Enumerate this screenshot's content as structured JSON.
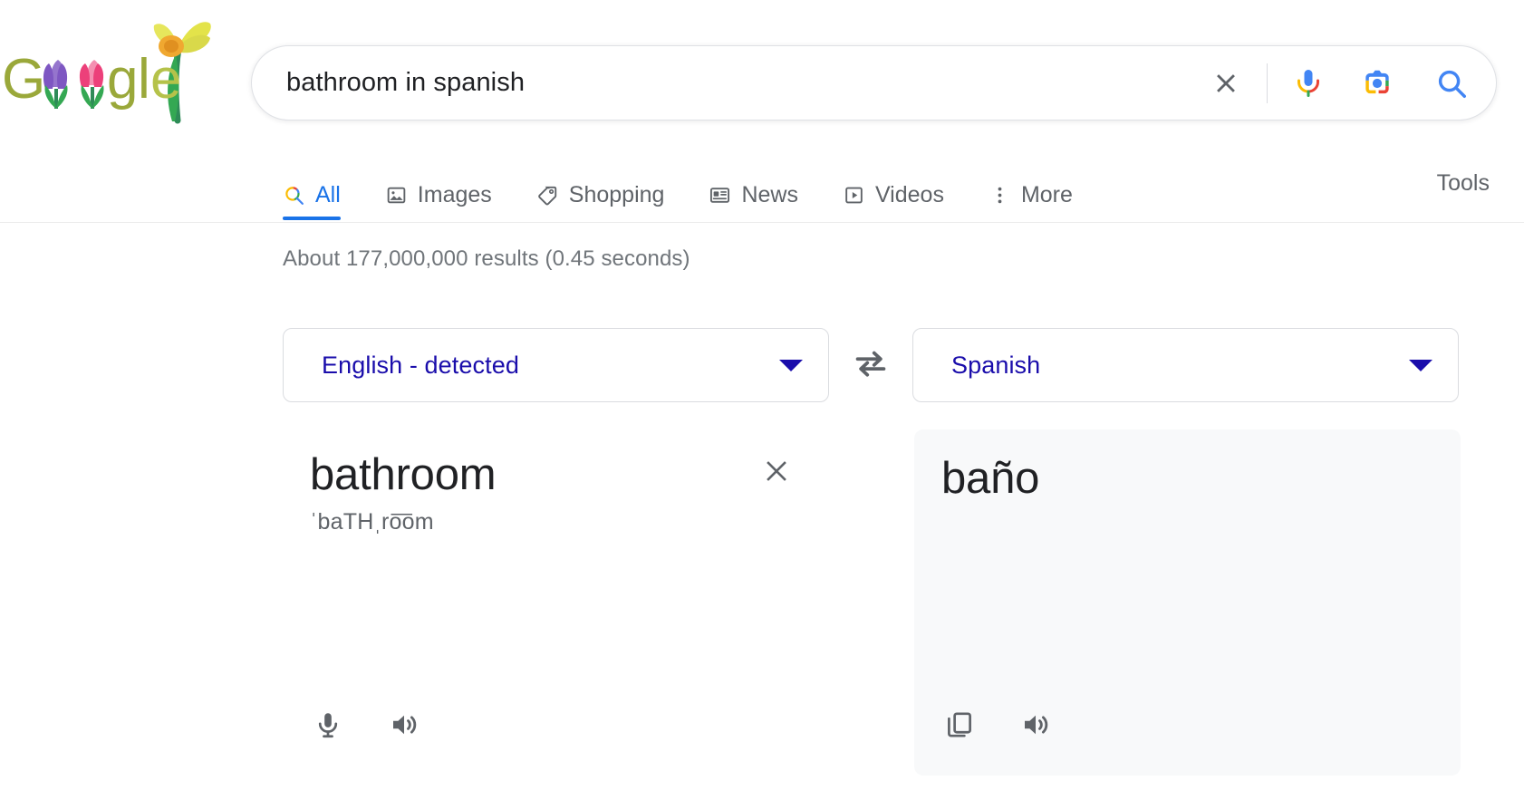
{
  "doodle": {
    "alt": "Google spring flowers doodle",
    "letters": "Google"
  },
  "search": {
    "query": "bathroom in spanish",
    "placeholder": "Search",
    "clear_icon": "close-icon",
    "mic_icon": "microphone-icon",
    "lens_icon": "google-lens-camera-icon",
    "search_icon": "search-icon"
  },
  "nav": {
    "tabs": [
      {
        "label": "All",
        "icon": "search-icon",
        "active": true
      },
      {
        "label": "Images",
        "icon": "image-icon",
        "active": false
      },
      {
        "label": "Shopping",
        "icon": "tag-icon",
        "active": false
      },
      {
        "label": "News",
        "icon": "newspaper-icon",
        "active": false
      },
      {
        "label": "Videos",
        "icon": "video-play-icon",
        "active": false
      },
      {
        "label": "More",
        "icon": "vertical-dots-icon",
        "active": false
      }
    ],
    "tools_label": "Tools"
  },
  "results": {
    "stats": "About 177,000,000 results (0.45 seconds)"
  },
  "translate": {
    "source_language": "English - detected",
    "target_language": "Spanish",
    "swap_icon": "swap-horizontal-icon",
    "source_text": "bathroom",
    "source_phonetic": "ˈbaTHˌro͞om",
    "target_text": "baño",
    "clear_icon": "close-icon",
    "source_mic_icon": "microphone-icon",
    "source_speaker_icon": "speaker-icon",
    "target_copy_icon": "copy-icon",
    "target_speaker_icon": "speaker-icon"
  },
  "colors": {
    "google_blue": "#1a73e8",
    "link_blue": "#1a0dab",
    "text_primary": "#202124",
    "text_secondary": "#5f6368",
    "stats_gray": "#70757a",
    "panel_bg": "#f8f9fa",
    "border": "#dadce0"
  }
}
